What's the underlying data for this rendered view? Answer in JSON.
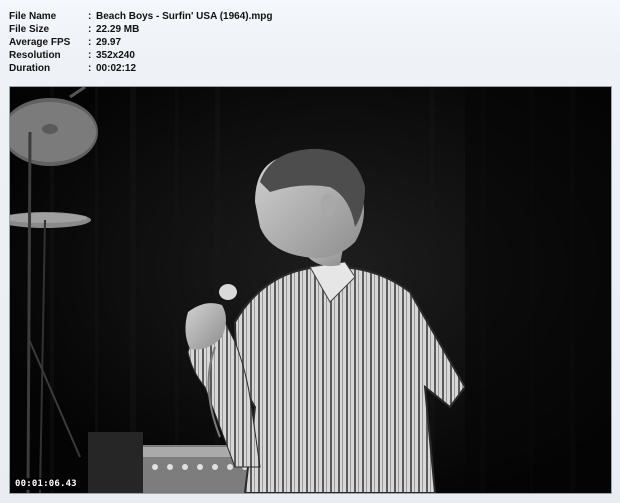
{
  "metadata": [
    {
      "key": "File Name",
      "sep": ":",
      "value": "Beach Boys - Surfin' USA (1964).mpg"
    },
    {
      "key": "File Size",
      "sep": ":",
      "value": "22.29 MB"
    },
    {
      "key": "Average FPS",
      "sep": ":",
      "value": "29.97"
    },
    {
      "key": "Resolution",
      "sep": ":",
      "value": "352x240"
    },
    {
      "key": "Duration",
      "sep": ":",
      "value": "00:02:12"
    }
  ],
  "video": {
    "timestamp": "00:01:06.43"
  }
}
